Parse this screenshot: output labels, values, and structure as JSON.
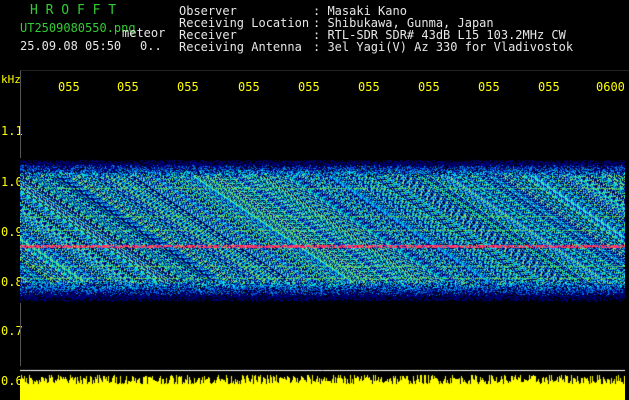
{
  "header": {
    "app_title": "H R O F F T",
    "file_name": "UT2509080550.png",
    "meteor_label": "meteor",
    "datetime": "25.09.08 05:50",
    "count": "0.."
  },
  "info": {
    "labels": [
      "Observer",
      "Receiving Location",
      "Receiver",
      "Receiving Antenna"
    ],
    "values": [
      ": Masaki Kano",
      ": Shibukawa, Gunma, Japan",
      ": RTL-SDR SDR# 43dB L15 103.2MHz CW",
      ": 3el Yagi(V) Az 330 for Vladivostok"
    ]
  },
  "axis": {
    "unit": "kHz",
    "time_ticks": [
      "055",
      "055",
      "055",
      "055",
      "055",
      "055",
      "055",
      "055",
      "055",
      "0600"
    ],
    "freq_ticks": [
      "1.1",
      "1.0",
      "0.9",
      "0.8",
      "0.7",
      "0.6"
    ]
  },
  "colors": {
    "text_green": "#33cc33",
    "tick_yellow": "#ffff00",
    "band_yellow": "#ffff00",
    "echo_red": "#ff2050"
  }
}
